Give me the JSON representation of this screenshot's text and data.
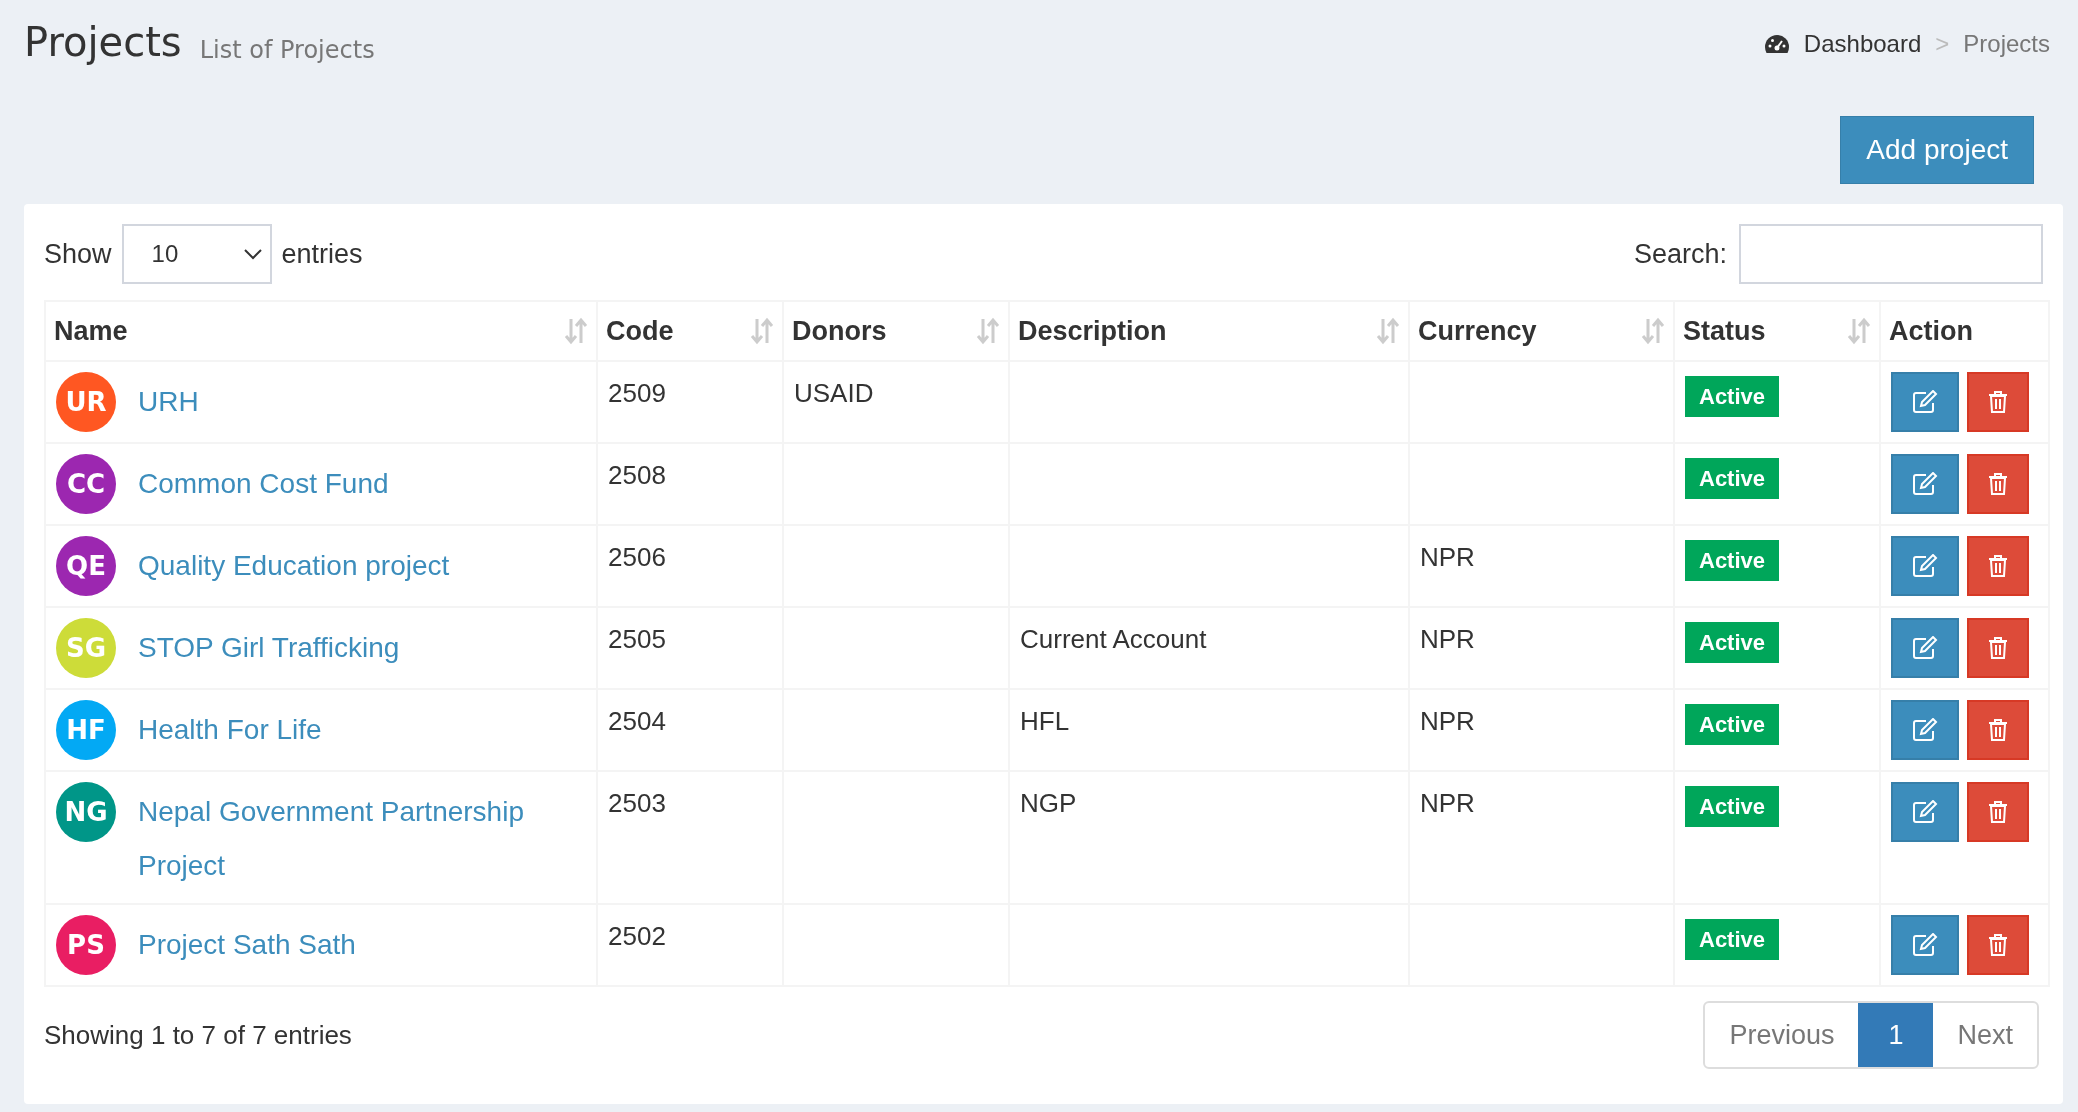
{
  "header": {
    "title": "Projects",
    "subtitle": "List of Projects"
  },
  "breadcrumb": {
    "items": [
      {
        "label": "Dashboard"
      },
      {
        "label": "Projects"
      }
    ],
    "separator": ">"
  },
  "add_button": "Add project",
  "length": {
    "show": "Show",
    "value": "10",
    "entries": "entries"
  },
  "search": {
    "label": "Search:"
  },
  "table": {
    "columns": [
      {
        "label": "Name",
        "sortable": true
      },
      {
        "label": "Code",
        "sortable": true
      },
      {
        "label": "Donors",
        "sortable": true
      },
      {
        "label": "Description",
        "sortable": true
      },
      {
        "label": "Currency",
        "sortable": true
      },
      {
        "label": "Status",
        "sortable": true
      },
      {
        "label": "Action",
        "sortable": false
      }
    ],
    "rows": [
      {
        "initials": "UR",
        "color": "#ff5722",
        "name": "URH",
        "code": "2509",
        "donors": "USAID",
        "description": "",
        "currency": "",
        "status": "Active"
      },
      {
        "initials": "CC",
        "color": "#9c27b0",
        "name": "Common Cost Fund",
        "code": "2508",
        "donors": "",
        "description": "",
        "currency": "",
        "status": "Active"
      },
      {
        "initials": "QE",
        "color": "#9c27b0",
        "name": "Quality Education project",
        "code": "2506",
        "donors": "",
        "description": "",
        "currency": "NPR",
        "status": "Active"
      },
      {
        "initials": "SG",
        "color": "#cddc39",
        "name": "STOP Girl Trafficking",
        "code": "2505",
        "donors": "",
        "description": "Current Account",
        "currency": "NPR",
        "status": "Active"
      },
      {
        "initials": "HF",
        "color": "#03a9f4",
        "name": "Health For Life",
        "code": "2504",
        "donors": "",
        "description": "HFL",
        "currency": "NPR",
        "status": "Active"
      },
      {
        "initials": "NG",
        "color": "#009688",
        "name": "Nepal Government Partnership Project",
        "code": "2503",
        "donors": "",
        "description": "NGP",
        "currency": "NPR",
        "status": "Active"
      },
      {
        "initials": "PS",
        "color": "#e91e63",
        "name": "Project Sath Sath",
        "code": "2502",
        "donors": "",
        "description": "",
        "currency": "",
        "status": "Active"
      }
    ]
  },
  "info": "Showing 1 to 7 of 7 entries",
  "pagination": {
    "previous": "Previous",
    "pages": [
      {
        "label": "1",
        "selected": true
      }
    ],
    "next": "Next"
  }
}
